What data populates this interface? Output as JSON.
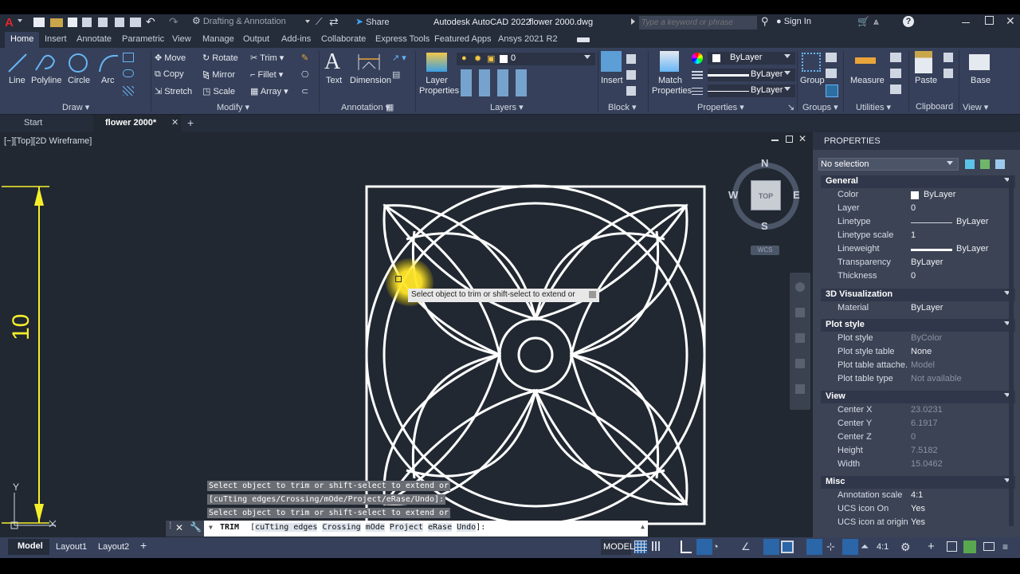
{
  "titlebar": {
    "workspace": "Drafting & Annotation",
    "share": "Share",
    "app_title": "Autodesk AutoCAD 2022",
    "file_name": "flower  2000.dwg",
    "search_placeholder": "Type a keyword or phrase",
    "signin": "Sign In"
  },
  "ribbon_tabs": [
    "Home",
    "Insert",
    "Annotate",
    "Parametric",
    "View",
    "Manage",
    "Output",
    "Add-ins",
    "Collaborate",
    "Express Tools",
    "Featured Apps",
    "Ansys  2021 R2"
  ],
  "ribbon": {
    "draw": {
      "line": "Line",
      "polyline": "Polyline",
      "circle": "Circle",
      "arc": "Arc",
      "label": "Draw"
    },
    "modify": {
      "move": "Move",
      "rotate": "Rotate",
      "trim": "Trim",
      "copy": "Copy",
      "mirror": "Mirror",
      "fillet": "Fillet",
      "stretch": "Stretch",
      "scale": "Scale",
      "array": "Array",
      "label": "Modify"
    },
    "annotation": {
      "text": "Text",
      "dimension": "Dimension",
      "label": "Annotation"
    },
    "layers": {
      "layer_properties": "Layer Properties",
      "current_layer": "0",
      "label": "Layers"
    },
    "block": {
      "insert": "Insert",
      "label": "Block"
    },
    "properties": {
      "match": "Match Properties",
      "color": "ByLayer",
      "linetype": "ByLayer",
      "lineweight": "ByLayer",
      "label": "Properties"
    },
    "groups": {
      "group": "Group",
      "label": "Groups"
    },
    "utilities": {
      "measure": "Measure",
      "label": "Utilities"
    },
    "clipboard": {
      "paste": "Paste",
      "label": "Clipboard"
    },
    "view": {
      "base": "Base",
      "label": "View"
    }
  },
  "doc_tabs": {
    "start": "Start",
    "active": "flower  2000*"
  },
  "viewport": {
    "label": "[−][Top][2D Wireframe]",
    "dimension_value": "10",
    "tooltip": "Select object to trim or shift-select to extend or",
    "viewcube": {
      "top": "TOP",
      "n": "N",
      "s": "S",
      "e": "E",
      "w": "W",
      "wcs": "WCS"
    },
    "ucs_y": "Y"
  },
  "command_history": [
    "Select object to trim or shift-select to extend or",
    "[cuTting edges/Crossing/mOde/Project/eRase/Undo]:",
    "Select object to trim or shift-select to extend or"
  ],
  "command_line": {
    "command": "TRIM",
    "options_prefix": "[",
    "options": [
      "cuTting edges",
      "Crossing",
      "mOde",
      "Project",
      "eRase",
      "Undo"
    ],
    "options_suffix": "]:"
  },
  "properties_panel": {
    "title": "PROPERTIES",
    "selection": "No selection",
    "sections": {
      "general": "General",
      "viz3d": "3D Visualization",
      "plot": "Plot style",
      "view": "View",
      "misc": "Misc"
    },
    "general": [
      {
        "k": "Color",
        "v": "ByLayer"
      },
      {
        "k": "Layer",
        "v": "0"
      },
      {
        "k": "Linetype",
        "v": "ByLayer"
      },
      {
        "k": "Linetype scale",
        "v": "1"
      },
      {
        "k": "Lineweight",
        "v": "ByLayer"
      },
      {
        "k": "Transparency",
        "v": "ByLayer"
      },
      {
        "k": "Thickness",
        "v": "0"
      }
    ],
    "viz3d": [
      {
        "k": "Material",
        "v": "ByLayer"
      }
    ],
    "plot": [
      {
        "k": "Plot style",
        "v": "ByColor"
      },
      {
        "k": "Plot style table",
        "v": "None"
      },
      {
        "k": "Plot table attache...",
        "v": "Model"
      },
      {
        "k": "Plot table type",
        "v": "Not available"
      }
    ],
    "view": [
      {
        "k": "Center X",
        "v": "23.0231"
      },
      {
        "k": "Center Y",
        "v": "6.1917"
      },
      {
        "k": "Center Z",
        "v": "0"
      },
      {
        "k": "Height",
        "v": "7.5182"
      },
      {
        "k": "Width",
        "v": "15.0462"
      }
    ],
    "misc": [
      {
        "k": "Annotation scale",
        "v": "4:1"
      },
      {
        "k": "UCS icon On",
        "v": "Yes"
      },
      {
        "k": "UCS icon at origin",
        "v": "Yes"
      }
    ]
  },
  "layout_tabs": [
    "Model",
    "Layout1",
    "Layout2"
  ],
  "status": {
    "model": "MODEL",
    "scale": "4:1"
  }
}
